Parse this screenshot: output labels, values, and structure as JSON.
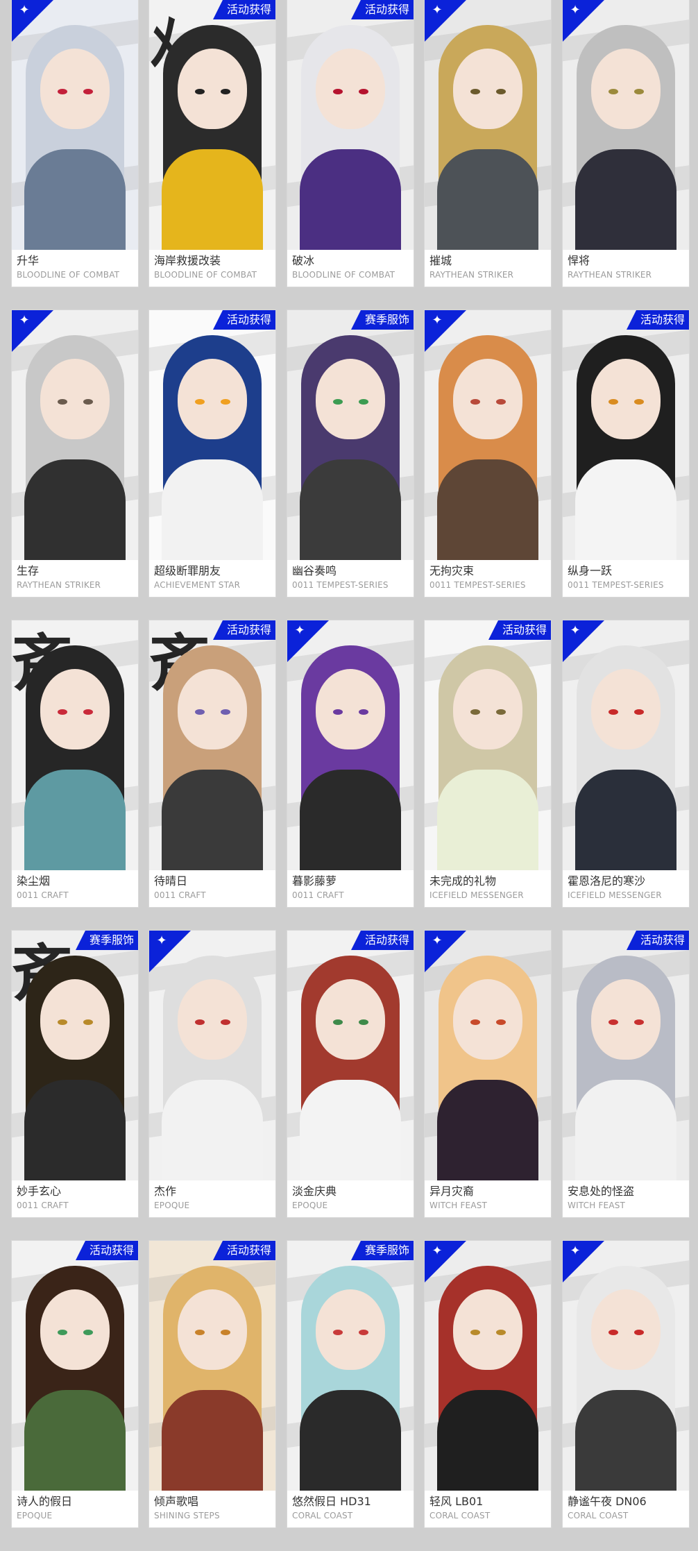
{
  "colors": {
    "badge": "#0b22d9",
    "background": "#cfcfcf"
  },
  "rows": [
    {
      "cards": [
        {
          "name": "升华",
          "series": "BLOODLINE OF COMBAT",
          "badge": "",
          "corner": true,
          "hair": "#c9d0dc",
          "body": "#6a7c95",
          "bg": "#e9ecf2",
          "eye": "#c3203a",
          "glyph": ""
        },
        {
          "name": "海岸救援改装",
          "series": "BLOODLINE OF COMBAT",
          "badge": "活动获得",
          "corner": false,
          "hair": "#2b2b2b",
          "body": "#e5b51c",
          "bg": "#f2f2f2",
          "eye": "#222",
          "glyph": "ﾒ"
        },
        {
          "name": "破冰",
          "series": "BLOODLINE OF COMBAT",
          "badge": "活动获得",
          "corner": false,
          "hair": "#e6e6ea",
          "body": "#4b2f82",
          "bg": "#eeeeee",
          "eye": "#b5122e",
          "glyph": ""
        },
        {
          "name": "摧城",
          "series": "RAYTHEAN STRIKER",
          "badge": "",
          "corner": true,
          "hair": "#c9a85a",
          "body": "#4d5257",
          "bg": "#e8e8e8",
          "eye": "#6b5a2c",
          "glyph": ""
        },
        {
          "name": "悍将",
          "series": "RAYTHEAN STRIKER",
          "badge": "",
          "corner": true,
          "hair": "#bfbfbf",
          "body": "#2f2f3a",
          "bg": "#ededed",
          "eye": "#9b8a3c",
          "glyph": ""
        }
      ]
    },
    {
      "cards": [
        {
          "name": "生存",
          "series": "RAYTHEAN STRIKER",
          "badge": "",
          "corner": true,
          "hair": "#c8c8c8",
          "body": "#303030",
          "bg": "#f0f0f0",
          "eye": "#6a5b4e",
          "glyph": ""
        },
        {
          "name": "超级断罪朋友",
          "series": "ACHIEVEMENT STAR",
          "badge": "活动获得",
          "corner": false,
          "hair": "#1d3e8c",
          "body": "#f2f2f2",
          "bg": "#fafafa",
          "eye": "#f0a020",
          "glyph": ""
        },
        {
          "name": "幽谷奏鸣",
          "series": "0011 TEMPEST-SERIES",
          "badge": "赛季服饰",
          "corner": false,
          "hair": "#4a3a6e",
          "body": "#3b3b3b",
          "bg": "#ececec",
          "eye": "#3c9c52",
          "glyph": ""
        },
        {
          "name": "无拘灾束",
          "series": "0011 TEMPEST-SERIES",
          "badge": "",
          "corner": true,
          "hair": "#d98c4a",
          "body": "#5e4636",
          "bg": "#efefef",
          "eye": "#b84a3a",
          "glyph": ""
        },
        {
          "name": "纵身一跃",
          "series": "0011 TEMPEST-SERIES",
          "badge": "活动获得",
          "corner": false,
          "hair": "#1f1f1f",
          "body": "#f4f4f4",
          "bg": "#ededed",
          "eye": "#d98c20",
          "glyph": ""
        }
      ]
    },
    {
      "cards": [
        {
          "name": "染尘烟",
          "series": "0011 CRAFT",
          "badge": "",
          "corner": false,
          "hair": "#262626",
          "body": "#5e9aa2",
          "bg": "#f2f2f2",
          "eye": "#c92a3a",
          "glyph": "斉"
        },
        {
          "name": "待晴日",
          "series": "0011 CRAFT",
          "badge": "活动获得",
          "corner": false,
          "hair": "#c9a07a",
          "body": "#3a3a3a",
          "bg": "#f0f0f0",
          "eye": "#6f5fb0",
          "glyph": "斉"
        },
        {
          "name": "暮影藤萝",
          "series": "0011 CRAFT",
          "badge": "",
          "corner": true,
          "hair": "#6a3aa0",
          "body": "#2a2a2a",
          "bg": "#f0f0f0",
          "eye": "#6a3aa0",
          "glyph": ""
        },
        {
          "name": "未完成的礼物",
          "series": "ICEFIELD MESSENGER",
          "badge": "活动获得",
          "corner": false,
          "hair": "#cfc7a6",
          "body": "#e9efd6",
          "bg": "#f6f6f6",
          "eye": "#7a6a3a",
          "glyph": ""
        },
        {
          "name": "霍恩洛尼的寒沙",
          "series": "ICEFIELD MESSENGER",
          "badge": "",
          "corner": true,
          "hair": "#e2e2e2",
          "body": "#2a2f3a",
          "bg": "#efefef",
          "eye": "#c82a2a",
          "glyph": ""
        }
      ]
    },
    {
      "cards": [
        {
          "name": "妙手玄心",
          "series": "0011 CRAFT",
          "badge": "赛季服饰",
          "corner": false,
          "hair": "#2d2518",
          "body": "#2b2b2b",
          "bg": "#efefef",
          "eye": "#b88a2a",
          "glyph": "斉"
        },
        {
          "name": "杰作",
          "series": "EPOQUE",
          "badge": "",
          "corner": true,
          "hair": "#dedede",
          "body": "#f2f2f2",
          "bg": "#f1f1f1",
          "eye": "#c03030",
          "glyph": ""
        },
        {
          "name": "淡金庆典",
          "series": "EPOQUE",
          "badge": "活动获得",
          "corner": false,
          "hair": "#a23a2e",
          "body": "#f3f3f3",
          "bg": "#f2f2f2",
          "eye": "#3e8a4a",
          "glyph": ""
        },
        {
          "name": "异月灾裔",
          "series": "WITCH FEAST",
          "badge": "",
          "corner": true,
          "hair": "#f0c48a",
          "body": "#2e2230",
          "bg": "#e8e8e8",
          "eye": "#c84a2a",
          "glyph": ""
        },
        {
          "name": "安息处的怪盗",
          "series": "WITCH FEAST",
          "badge": "活动获得",
          "corner": false,
          "hair": "#b9bcc6",
          "body": "#f1f1f1",
          "bg": "#ececec",
          "eye": "#c83030",
          "glyph": ""
        }
      ]
    },
    {
      "cards": [
        {
          "name": "诗人的假日",
          "series": "EPOQUE",
          "badge": "活动获得",
          "corner": false,
          "hair": "#3a2418",
          "body": "#4a6a3a",
          "bg": "#f2f2f2",
          "eye": "#3e9a5a",
          "glyph": ""
        },
        {
          "name": "倾声歌唱",
          "series": "SHINING STEPS",
          "badge": "活动获得",
          "corner": false,
          "hair": "#e0b46a",
          "body": "#8a3a2a",
          "bg": "#f1e6d6",
          "eye": "#c8822a",
          "glyph": ""
        },
        {
          "name": "悠然假日 HD31",
          "series": "CORAL COAST",
          "badge": "赛季服饰",
          "corner": false,
          "hair": "#a9d6da",
          "body": "#2a2a2a",
          "bg": "#f1f1f1",
          "eye": "#c83a3a",
          "glyph": ""
        },
        {
          "name": "轻风 LB01",
          "series": "CORAL COAST",
          "badge": "",
          "corner": true,
          "hair": "#a6312a",
          "body": "#1f1f1f",
          "bg": "#ededed",
          "eye": "#b88a2a",
          "glyph": ""
        },
        {
          "name": "静谧午夜 DN06",
          "series": "CORAL COAST",
          "badge": "",
          "corner": true,
          "hair": "#e8e8e8",
          "body": "#3a3a3a",
          "bg": "#efefef",
          "eye": "#c82a2a",
          "glyph": ""
        }
      ]
    }
  ]
}
